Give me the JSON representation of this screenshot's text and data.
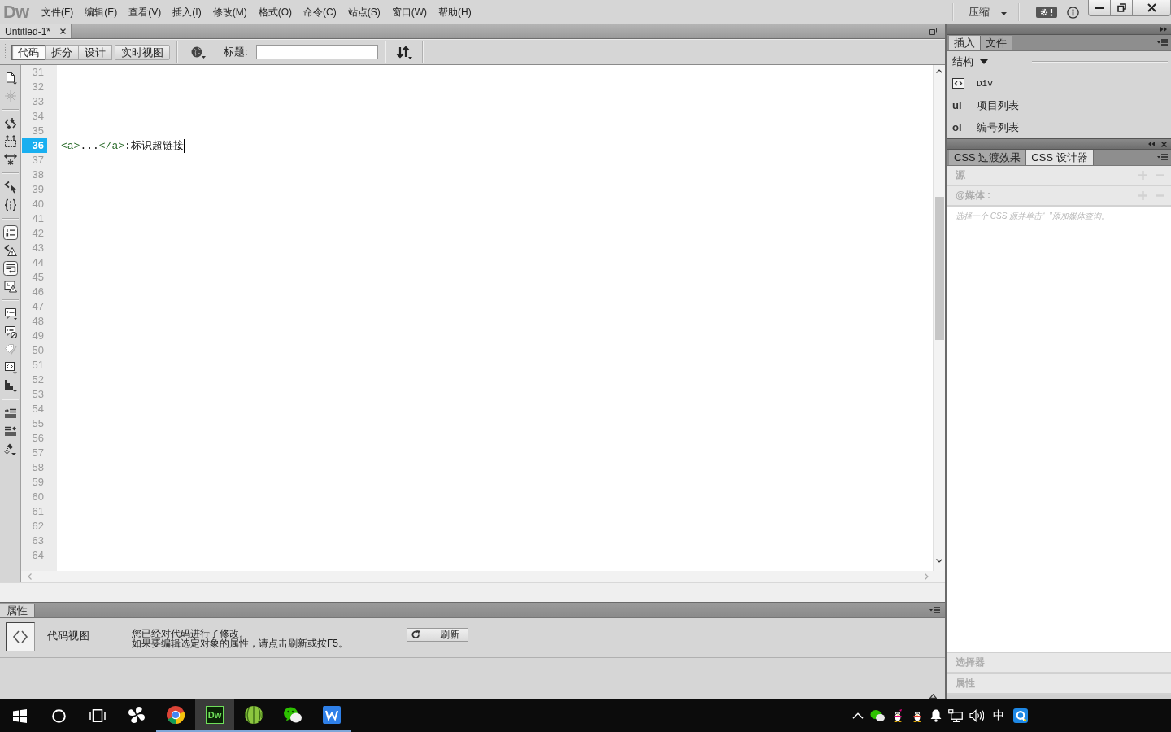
{
  "app": {
    "logo": "Dw"
  },
  "menu": [
    "文件(F)",
    "编辑(E)",
    "查看(V)",
    "插入(I)",
    "修改(M)",
    "格式(O)",
    "命令(C)",
    "站点(S)",
    "窗口(W)",
    "帮助(H)"
  ],
  "workspace": {
    "label": "压缩"
  },
  "document_tab": {
    "title": "Untitled-1*"
  },
  "view_buttons": [
    {
      "label": "代码",
      "selected": true
    },
    {
      "label": "拆分",
      "selected": false
    },
    {
      "label": "设计",
      "selected": false
    },
    {
      "label": "实时视图",
      "selected": false
    }
  ],
  "title_field": {
    "label": "标题:"
  },
  "coding_toolbar": {
    "groups": [
      [
        {
          "kind": "document",
          "disabled": false,
          "on": false
        },
        {
          "kind": "asterisk",
          "disabled": true,
          "on": false
        }
      ],
      [
        {
          "kind": "collapse-tag",
          "disabled": false,
          "on": false
        },
        {
          "kind": "collapse-selection",
          "disabled": false,
          "on": false
        },
        {
          "kind": "expand-all",
          "disabled": false,
          "on": false
        }
      ],
      [
        {
          "kind": "select-parent",
          "disabled": false,
          "on": false
        },
        {
          "kind": "braces",
          "disabled": false,
          "on": false
        }
      ],
      [
        {
          "kind": "line-numbers",
          "disabled": false,
          "on": true
        },
        {
          "kind": "invalid-code",
          "disabled": false,
          "on": false
        },
        {
          "kind": "word-wrap",
          "disabled": false,
          "on": true
        },
        {
          "kind": "syntax-alert",
          "disabled": false,
          "on": false
        }
      ],
      [
        {
          "kind": "comment",
          "disabled": false,
          "on": false
        },
        {
          "kind": "uncomment",
          "disabled": false,
          "on": false
        },
        {
          "kind": "wrap-tag",
          "disabled": true,
          "on": false
        },
        {
          "kind": "snippets",
          "disabled": false,
          "on": false
        },
        {
          "kind": "move-css",
          "disabled": false,
          "on": false
        }
      ],
      [
        {
          "kind": "indent",
          "disabled": false,
          "on": false
        },
        {
          "kind": "outdent",
          "disabled": false,
          "on": false
        },
        {
          "kind": "format",
          "disabled": false,
          "on": false
        }
      ]
    ]
  },
  "editor": {
    "lines": [
      {
        "number": "31",
        "selected": false
      },
      {
        "number": "32",
        "selected": false
      },
      {
        "number": "33",
        "selected": false
      },
      {
        "number": "34",
        "selected": false
      },
      {
        "number": "35",
        "selected": false
      },
      {
        "number": "36",
        "selected": true,
        "tokens": [
          {
            "kind": "tag",
            "text": "<a>"
          },
          {
            "kind": "text",
            "text": "..."
          },
          {
            "kind": "tag",
            "text": "</a>"
          },
          {
            "kind": "text",
            "text": ":标识超链接"
          }
        ]
      },
      {
        "number": "37",
        "selected": false
      },
      {
        "number": "38",
        "selected": false
      },
      {
        "number": "39",
        "selected": false
      },
      {
        "number": "40",
        "selected": false
      },
      {
        "number": "41",
        "selected": false
      },
      {
        "number": "42",
        "selected": false
      },
      {
        "number": "43",
        "selected": false
      },
      {
        "number": "44",
        "selected": false
      },
      {
        "number": "45",
        "selected": false
      },
      {
        "number": "46",
        "selected": false
      },
      {
        "number": "47",
        "selected": false
      },
      {
        "number": "48",
        "selected": false
      },
      {
        "number": "49",
        "selected": false
      },
      {
        "number": "50",
        "selected": false
      },
      {
        "number": "51",
        "selected": false
      },
      {
        "number": "52",
        "selected": false
      },
      {
        "number": "53",
        "selected": false
      },
      {
        "number": "54",
        "selected": false
      },
      {
        "number": "55",
        "selected": false
      },
      {
        "number": "56",
        "selected": false
      },
      {
        "number": "57",
        "selected": false
      },
      {
        "number": "58",
        "selected": false
      },
      {
        "number": "59",
        "selected": false
      },
      {
        "number": "60",
        "selected": false
      },
      {
        "number": "61",
        "selected": false
      },
      {
        "number": "62",
        "selected": false
      },
      {
        "number": "63",
        "selected": false
      },
      {
        "number": "64",
        "selected": false
      }
    ]
  },
  "properties": {
    "tab": "属性",
    "mode": "代码视图",
    "message": [
      "您已经对代码进行了修改。",
      "如果要编辑选定对象的属性，请点击刷新或按F5。"
    ],
    "refresh_button": "刷新"
  },
  "insert_panel": {
    "tabs": [
      {
        "label": "插入",
        "selected": true
      },
      {
        "label": "文件",
        "selected": false
      }
    ],
    "category": "结构",
    "items": [
      {
        "kind": "icon",
        "label": "Div"
      },
      {
        "kind": "abbreviation",
        "tag": "ul",
        "label": "项目列表"
      },
      {
        "kind": "abbreviation",
        "tag": "ol",
        "label": "编号列表"
      }
    ]
  },
  "css_panel": {
    "tabs": [
      {
        "label": "CSS 过渡效果",
        "selected": false
      },
      {
        "label": "CSS 设计器",
        "selected": true
      }
    ],
    "sections": [
      {
        "title": "源",
        "controls": true
      },
      {
        "title": "@媒体 :",
        "controls": true
      }
    ],
    "hint": "选择一个 CSS 源并单击“+”添加媒体查询。",
    "footer_sections": [
      {
        "title": "选择器"
      },
      {
        "title": "属性"
      }
    ]
  },
  "taskbar": {
    "apps": [
      {
        "kind": "pinwheel",
        "running": false,
        "selected": false
      },
      {
        "kind": "browser",
        "running": true,
        "selected": false
      },
      {
        "kind": "tile",
        "text": "Dw",
        "running": true,
        "selected": true
      },
      {
        "kind": "ball",
        "running": true,
        "selected": false
      },
      {
        "kind": "chat",
        "running": true,
        "selected": false
      },
      {
        "kind": "zigzag",
        "running": true,
        "selected": false
      }
    ],
    "tray": [
      {
        "kind": "chevron"
      },
      {
        "kind": "chat"
      },
      {
        "kind": "penguin-pink"
      },
      {
        "kind": "penguin-red"
      },
      {
        "kind": "bell"
      },
      {
        "kind": "network"
      },
      {
        "kind": "volume"
      },
      {
        "kind": "ime",
        "text": "中"
      },
      {
        "kind": "ring-tile"
      }
    ]
  }
}
